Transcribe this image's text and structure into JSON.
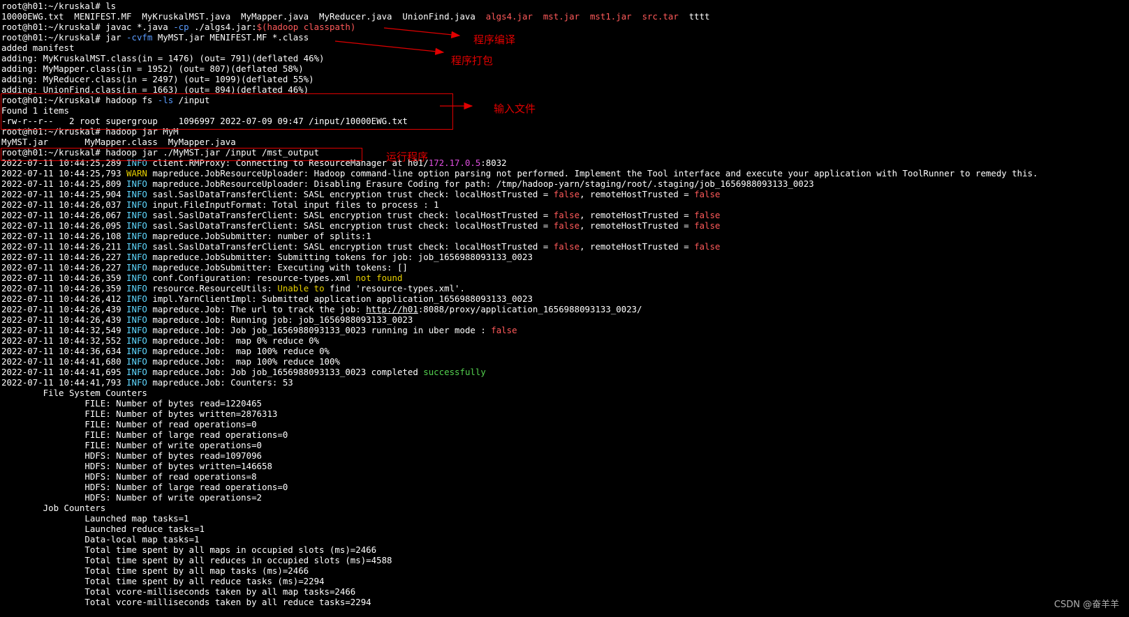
{
  "colors": {
    "background": "#000000",
    "text": "#ffffff",
    "red": "#ff5a5a",
    "green": "#54d24f",
    "yellow": "#e8d000",
    "magenta": "#e14fe1",
    "cyan": "#5fd7ff",
    "blue": "#5b9cff",
    "annotation": "#e00000"
  },
  "terminal_lines": [
    [
      {
        "t": "root@h01:~/kruskal# ls"
      }
    ],
    [
      {
        "t": "10000EWG.txt  MENIFEST.MF  MyKruskalMST.java  MyMapper.java  MyReducer.java  UnionFind.java  "
      },
      {
        "t": "algs4.jar",
        "c": "red"
      },
      {
        "t": "  "
      },
      {
        "t": "mst.jar",
        "c": "red"
      },
      {
        "t": "  "
      },
      {
        "t": "mst1.jar",
        "c": "red"
      },
      {
        "t": "  "
      },
      {
        "t": "src.tar",
        "c": "red"
      },
      {
        "t": "  tttt"
      }
    ],
    [
      {
        "t": "root@h01:~/kruskal# javac *.java "
      },
      {
        "t": "-cp",
        "c": "blue"
      },
      {
        "t": " ./algs4.jar:"
      },
      {
        "t": "$(hadoop classpath)",
        "c": "red"
      }
    ],
    [
      {
        "t": "root@h01:~/kruskal# jar "
      },
      {
        "t": "-cvfm",
        "c": "blue"
      },
      {
        "t": " MyMST.jar MENIFEST.MF *.class"
      }
    ],
    [
      {
        "t": "added manifest"
      }
    ],
    [
      {
        "t": "adding: MyKruskalMST.class(in = 1476) (out= 791)(deflated 46%)"
      }
    ],
    [
      {
        "t": "adding: MyMapper.class(in = 1952) (out= 807)(deflated 58%)"
      }
    ],
    [
      {
        "t": "adding: MyReducer.class(in = 2497) (out= 1099)(deflated 55%)"
      }
    ],
    [
      {
        "t": "adding: UnionFind.class(in = 1663) (out= 894)(deflated 46%)"
      }
    ],
    [
      {
        "t": "root@h01:~/kruskal# hadoop fs "
      },
      {
        "t": "-ls",
        "c": "blue"
      },
      {
        "t": " /input"
      }
    ],
    [
      {
        "t": "Found 1 items"
      }
    ],
    [
      {
        "t": "-rw-r--r--   2 root supergroup    1096997 2022-07-09 09:47 /input/10000EWG.txt"
      }
    ],
    [
      {
        "t": "root@h01:~/kruskal# hadoop jar MyM"
      }
    ],
    [
      {
        "t": "MyMST.jar       MyMapper.class  MyMapper.java"
      }
    ],
    [
      {
        "t": "root@h01:~/kruskal# hadoop jar ./MyMST.jar /input /mst_output"
      }
    ],
    [
      {
        "t": "2022-07-11 10:44:25,289 "
      },
      {
        "t": "INFO",
        "c": "cyan"
      },
      {
        "t": " client.RMProxy: Connecting to ResourceManager at h01/"
      },
      {
        "t": "172.17.0.5",
        "c": "mag"
      },
      {
        "t": ":8032"
      }
    ],
    [
      {
        "t": "2022-07-11 10:44:25,793 "
      },
      {
        "t": "WARN",
        "c": "yel"
      },
      {
        "t": " mapreduce.JobResourceUploader: Hadoop command-line option parsing not performed. Implement the Tool interface and execute your application with ToolRunner to remedy this."
      }
    ],
    [
      {
        "t": "2022-07-11 10:44:25,809 "
      },
      {
        "t": "INFO",
        "c": "cyan"
      },
      {
        "t": " mapreduce.JobResourceUploader: Disabling Erasure Coding for path: /tmp/hadoop-yarn/staging/root/.staging/job_1656988093133_0023"
      }
    ],
    [
      {
        "t": "2022-07-11 10:44:25,904 "
      },
      {
        "t": "INFO",
        "c": "cyan"
      },
      {
        "t": " sasl.SaslDataTransferClient: SASL encryption trust check: localHostTrusted = "
      },
      {
        "t": "false",
        "c": "red"
      },
      {
        "t": ", remoteHostTrusted = "
      },
      {
        "t": "false",
        "c": "red"
      }
    ],
    [
      {
        "t": "2022-07-11 10:44:26,037 "
      },
      {
        "t": "INFO",
        "c": "cyan"
      },
      {
        "t": " input.FileInputFormat: Total input files to process : 1"
      }
    ],
    [
      {
        "t": "2022-07-11 10:44:26,067 "
      },
      {
        "t": "INFO",
        "c": "cyan"
      },
      {
        "t": " sasl.SaslDataTransferClient: SASL encryption trust check: localHostTrusted = "
      },
      {
        "t": "false",
        "c": "red"
      },
      {
        "t": ", remoteHostTrusted = "
      },
      {
        "t": "false",
        "c": "red"
      }
    ],
    [
      {
        "t": "2022-07-11 10:44:26,095 "
      },
      {
        "t": "INFO",
        "c": "cyan"
      },
      {
        "t": " sasl.SaslDataTransferClient: SASL encryption trust check: localHostTrusted = "
      },
      {
        "t": "false",
        "c": "red"
      },
      {
        "t": ", remoteHostTrusted = "
      },
      {
        "t": "false",
        "c": "red"
      }
    ],
    [
      {
        "t": "2022-07-11 10:44:26,108 "
      },
      {
        "t": "INFO",
        "c": "cyan"
      },
      {
        "t": " mapreduce.JobSubmitter: number of splits:1"
      }
    ],
    [
      {
        "t": "2022-07-11 10:44:26,211 "
      },
      {
        "t": "INFO",
        "c": "cyan"
      },
      {
        "t": " sasl.SaslDataTransferClient: SASL encryption trust check: localHostTrusted = "
      },
      {
        "t": "false",
        "c": "red"
      },
      {
        "t": ", remoteHostTrusted = "
      },
      {
        "t": "false",
        "c": "red"
      }
    ],
    [
      {
        "t": "2022-07-11 10:44:26,227 "
      },
      {
        "t": "INFO",
        "c": "cyan"
      },
      {
        "t": " mapreduce.JobSubmitter: Submitting tokens for job: job_1656988093133_0023"
      }
    ],
    [
      {
        "t": "2022-07-11 10:44:26,227 "
      },
      {
        "t": "INFO",
        "c": "cyan"
      },
      {
        "t": " mapreduce.JobSubmitter: Executing with tokens: []"
      }
    ],
    [
      {
        "t": "2022-07-11 10:44:26,359 "
      },
      {
        "t": "INFO",
        "c": "cyan"
      },
      {
        "t": " conf.Configuration: resource-types.xml "
      },
      {
        "t": "not found",
        "c": "yel"
      }
    ],
    [
      {
        "t": "2022-07-11 10:44:26,359 "
      },
      {
        "t": "INFO",
        "c": "cyan"
      },
      {
        "t": " resource.ResourceUtils: "
      },
      {
        "t": "Unable to",
        "c": "yel"
      },
      {
        "t": " find 'resource-types.xml'."
      }
    ],
    [
      {
        "t": "2022-07-11 10:44:26,412 "
      },
      {
        "t": "INFO",
        "c": "cyan"
      },
      {
        "t": " impl.YarnClientImpl: Submitted application application_1656988093133_0023"
      }
    ],
    [
      {
        "t": "2022-07-11 10:44:26,439 "
      },
      {
        "t": "INFO",
        "c": "cyan"
      },
      {
        "t": " mapreduce.Job: The url to track the job: "
      },
      {
        "t": "http://h01",
        "c": "link"
      },
      {
        "t": ":8088/proxy/application_1656988093133_0023/"
      }
    ],
    [
      {
        "t": "2022-07-11 10:44:26,439 "
      },
      {
        "t": "INFO",
        "c": "cyan"
      },
      {
        "t": " mapreduce.Job: Running job: job_1656988093133_0023"
      }
    ],
    [
      {
        "t": "2022-07-11 10:44:32,549 "
      },
      {
        "t": "INFO",
        "c": "cyan"
      },
      {
        "t": " mapreduce.Job: Job job_1656988093133_0023 running in uber mode : "
      },
      {
        "t": "false",
        "c": "red"
      }
    ],
    [
      {
        "t": "2022-07-11 10:44:32,552 "
      },
      {
        "t": "INFO",
        "c": "cyan"
      },
      {
        "t": " mapreduce.Job:  map 0% reduce 0%"
      }
    ],
    [
      {
        "t": "2022-07-11 10:44:36,634 "
      },
      {
        "t": "INFO",
        "c": "cyan"
      },
      {
        "t": " mapreduce.Job:  map 100% reduce 0%"
      }
    ],
    [
      {
        "t": "2022-07-11 10:44:41,680 "
      },
      {
        "t": "INFO",
        "c": "cyan"
      },
      {
        "t": " mapreduce.Job:  map 100% reduce 100%"
      }
    ],
    [
      {
        "t": "2022-07-11 10:44:41,695 "
      },
      {
        "t": "INFO",
        "c": "cyan"
      },
      {
        "t": " mapreduce.Job: Job job_1656988093133_0023 completed "
      },
      {
        "t": "successfully",
        "c": "grn"
      }
    ],
    [
      {
        "t": "2022-07-11 10:44:41,793 "
      },
      {
        "t": "INFO",
        "c": "cyan"
      },
      {
        "t": " mapreduce.Job: Counters: 53"
      }
    ],
    [
      {
        "t": "        File System Counters"
      }
    ],
    [
      {
        "t": "                FILE: Number of bytes read=1220465"
      }
    ],
    [
      {
        "t": "                FILE: Number of bytes written=2876313"
      }
    ],
    [
      {
        "t": "                FILE: Number of read operations=0"
      }
    ],
    [
      {
        "t": "                FILE: Number of large read operations=0"
      }
    ],
    [
      {
        "t": "                FILE: Number of write operations=0"
      }
    ],
    [
      {
        "t": "                HDFS: Number of bytes read=1097096"
      }
    ],
    [
      {
        "t": "                HDFS: Number of bytes written=146658"
      }
    ],
    [
      {
        "t": "                HDFS: Number of read operations=8"
      }
    ],
    [
      {
        "t": "                HDFS: Number of large read operations=0"
      }
    ],
    [
      {
        "t": "                HDFS: Number of write operations=2"
      }
    ],
    [
      {
        "t": "        Job Counters"
      }
    ],
    [
      {
        "t": "                Launched map tasks=1"
      }
    ],
    [
      {
        "t": "                Launched reduce tasks=1"
      }
    ],
    [
      {
        "t": "                Data-local map tasks=1"
      }
    ],
    [
      {
        "t": "                Total time spent by all maps in occupied slots (ms)=2466"
      }
    ],
    [
      {
        "t": "                Total time spent by all reduces in occupied slots (ms)=4588"
      }
    ],
    [
      {
        "t": "                Total time spent by all map tasks (ms)=2466"
      }
    ],
    [
      {
        "t": "                Total time spent by all reduce tasks (ms)=2294"
      }
    ],
    [
      {
        "t": "                Total vcore-milliseconds taken by all map tasks=2466"
      }
    ],
    [
      {
        "t": "                Total vcore-milliseconds taken by all reduce tasks=2294"
      }
    ]
  ],
  "annotations": {
    "compile": "程序编译",
    "package": "程序打包",
    "input_file": "输入文件",
    "run": "运行程序"
  },
  "watermark": "CSDN @奋羊羊"
}
